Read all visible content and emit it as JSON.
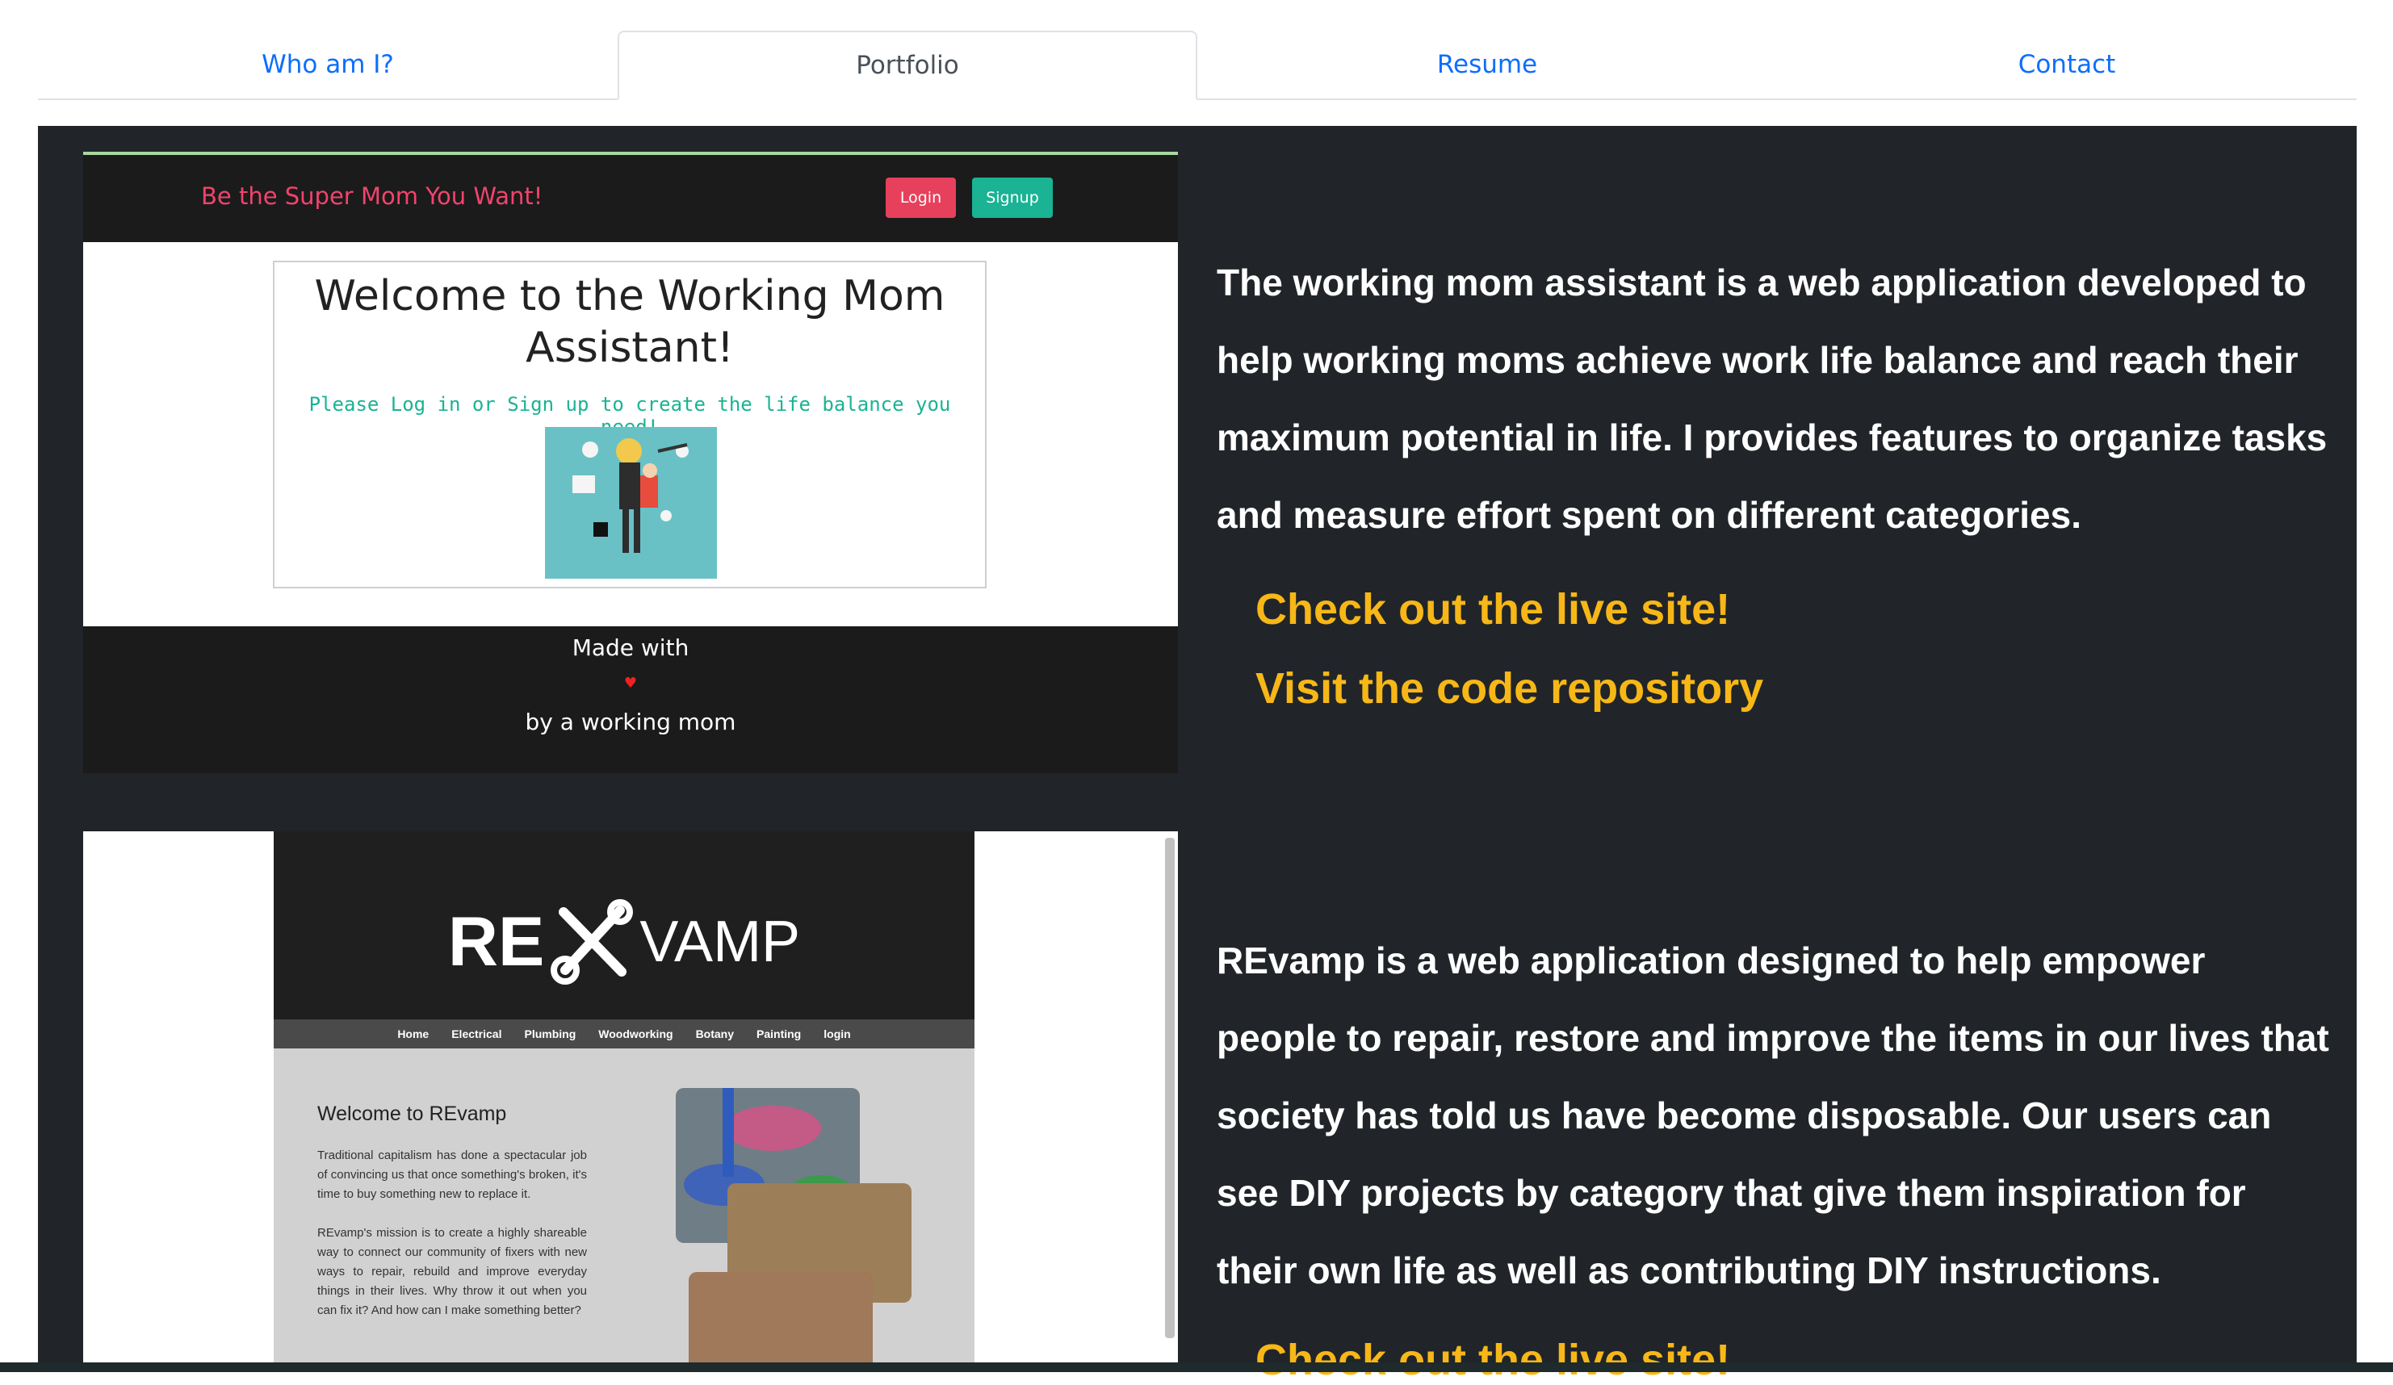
{
  "tabs": [
    {
      "label": "Who am I?",
      "active": false
    },
    {
      "label": "Portfolio",
      "active": true
    },
    {
      "label": "Resume",
      "active": false
    },
    {
      "label": "Contact",
      "active": false
    }
  ],
  "projects": [
    {
      "screenshot": {
        "brand": "Be the Super Mom You Want!",
        "login_label": "Login",
        "signup_label": "Signup",
        "title": "Welcome to the Working Mom Assistant!",
        "subtitle": "Please Log in or Sign up to create the life balance you need!",
        "footer_line1": "Made with",
        "heart": "♥",
        "footer_line2": "by a working mom"
      },
      "description": "The working mom assistant is a web application developed to help working moms achieve work life balance and reach their maximum potential in life. I provides features to organize tasks and measure effort spent on different categories.",
      "live_link": "Check out the live site!",
      "repo_link": "Visit the code repository"
    },
    {
      "screenshot": {
        "logo_left": "RE",
        "logo_right": "VAMP",
        "nav": [
          "Home",
          "Electrical",
          "Plumbing",
          "Woodworking",
          "Botany",
          "Painting",
          "login"
        ],
        "welcome": "Welcome to REvamp",
        "paragraph1": "Traditional capitalism has done a spectacular job of convincing us that once something's broken, it's time to buy something new to replace it.",
        "paragraph2": "REvamp's mission is to create a highly shareable way to connect our community of fixers with new ways to repair, rebuild and improve everyday things in their lives. Why throw it out when you can fix it? And how can I make something better?"
      },
      "description": "REvamp is a web application designed to help empower people to repair, restore and improve the items in our lives that society has told us have become disposable. Our users can see DIY projects by category that give them inspiration for their own life as well as contributing DIY instructions.",
      "live_link": "Check out the live site!"
    }
  ],
  "colors": {
    "panel_bg": "#212529",
    "link": "#f7b717",
    "tab_link": "#0d6efd"
  }
}
